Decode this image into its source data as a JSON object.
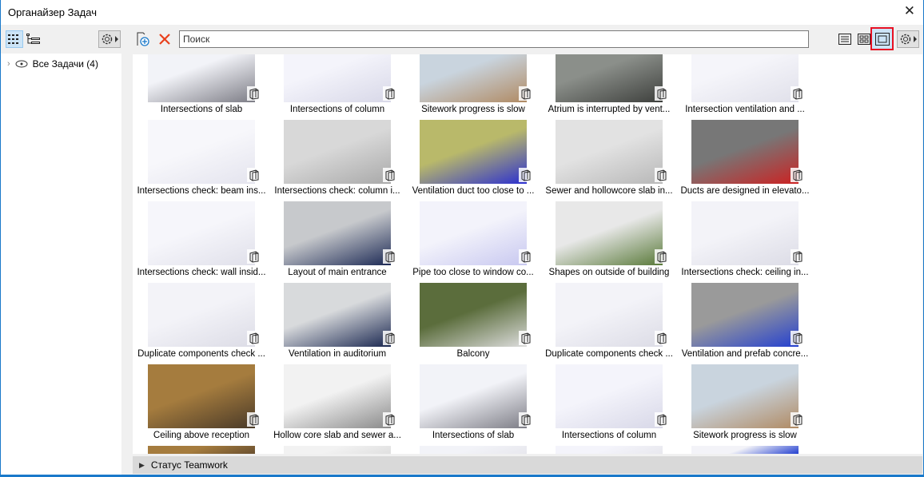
{
  "window": {
    "title": "Органайзер Задач",
    "close": "✕"
  },
  "tree": {
    "root_label": "Все Задачи (4)"
  },
  "search": {
    "placeholder": "Поиск"
  },
  "status_panel": {
    "label": "Статус Teamwork"
  },
  "colors": {
    "accent": "#1979ca",
    "selected_view_border": "#e81123",
    "delete": "#e8401c"
  },
  "items": [
    {
      "label": "Intersections of slab",
      "c1": "#f2f3f8",
      "c2": "#7d7d86"
    },
    {
      "label": "Intersections of column",
      "c1": "#f4f4fb",
      "c2": "#d8d8e8"
    },
    {
      "label": "Sitework progress is slow",
      "c1": "#c9d4de",
      "c2": "#b08a63"
    },
    {
      "label": "Atrium is interrupted by vent...",
      "c1": "#8b8f8a",
      "c2": "#3e403d"
    },
    {
      "label": "Intersection ventilation and ...",
      "c1": "#f5f5fa",
      "c2": "#e0e0ea"
    },
    {
      "label": "Intersections check: beam ins...",
      "c1": "#f7f7fb",
      "c2": "#e4e4ee"
    },
    {
      "label": "Intersections check: column i...",
      "c1": "#d8d8d8",
      "c2": "#a9a9a9"
    },
    {
      "label": "Ventilation duct too close to ...",
      "c1": "#b9b96a",
      "c2": "#2b2fd0"
    },
    {
      "label": "Sewer and hollowcore slab in...",
      "c1": "#e2e2e2",
      "c2": "#b8b8b8"
    },
    {
      "label": "Ducts are designed in elevato...",
      "c1": "#777",
      "c2": "#c22"
    },
    {
      "label": "Intersections check: wall insid...",
      "c1": "#f6f6fb",
      "c2": "#e0e0ea"
    },
    {
      "label": "Layout of main entrance",
      "c1": "#c7c9cc",
      "c2": "#1d2a55"
    },
    {
      "label": "Pipe too close to window co...",
      "c1": "#f3f3fb",
      "c2": "#c8c8f0"
    },
    {
      "label": "Shapes on outside of building",
      "c1": "#e8e8e8",
      "c2": "#5a7a3a"
    },
    {
      "label": "Intersections check: ceiling in...",
      "c1": "#f3f3f8",
      "c2": "#dcdce6"
    },
    {
      "label": "Duplicate components check ...",
      "c1": "#f3f3f8",
      "c2": "#dcdce6"
    },
    {
      "label": "Ventilation in auditorium",
      "c1": "#d8dadc",
      "c2": "#1a2750"
    },
    {
      "label": "Balcony",
      "c1": "#5b6d3c",
      "c2": "#ddd"
    },
    {
      "label": "Duplicate components check ...",
      "c1": "#f3f3f8",
      "c2": "#dcdce6"
    },
    {
      "label": "Ventilation and prefab concre...",
      "c1": "#9a9a9a",
      "c2": "#2440d0"
    },
    {
      "label": "Ceiling above reception",
      "c1": "#a57c3e",
      "c2": "#4a3a28"
    },
    {
      "label": "Hollow core slab and sewer a...",
      "c1": "#f2f2f2",
      "c2": "#8a8a8a"
    },
    {
      "label": "Intersections of slab",
      "c1": "#f2f3f8",
      "c2": "#7d7d86"
    },
    {
      "label": "Intersections of column",
      "c1": "#f4f4fb",
      "c2": "#d8d8e8"
    },
    {
      "label": "Sitework progress is slow",
      "c1": "#c9d4de",
      "c2": "#b08a63"
    },
    {
      "label": "",
      "c1": "#a57c3e",
      "c2": "#6a5030"
    },
    {
      "label": "",
      "c1": "#f2f2f2",
      "c2": "#e0e0e0"
    },
    {
      "label": "",
      "c1": "#f2f3f8",
      "c2": "#e8e8ee"
    },
    {
      "label": "",
      "c1": "#f4f4fb",
      "c2": "#e8e8ee"
    },
    {
      "label": "",
      "c1": "#f3f3f8",
      "c2": "#2440d0"
    }
  ]
}
